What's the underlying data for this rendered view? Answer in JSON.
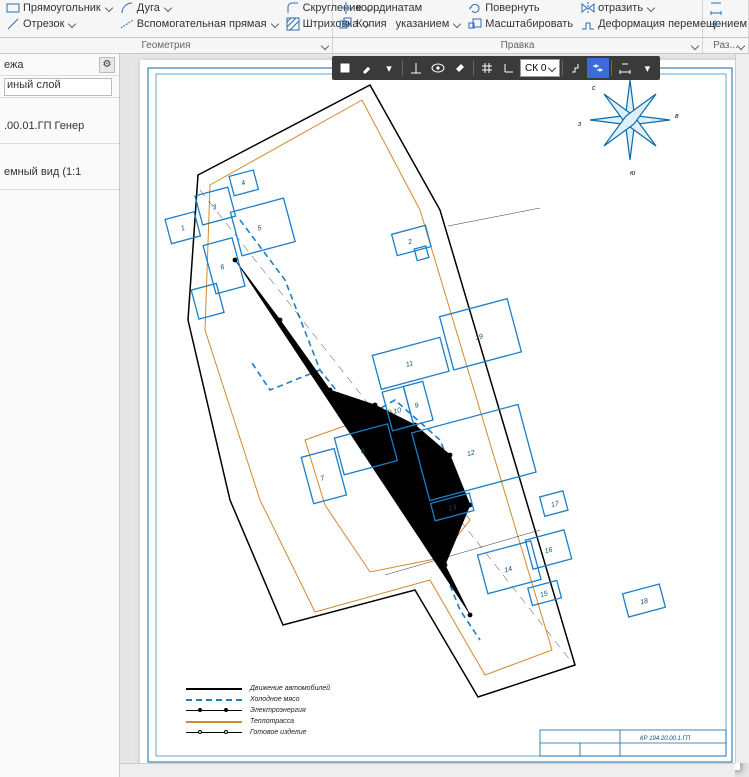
{
  "ribbon": {
    "geom": {
      "label": "Геометрия",
      "rect": "Прямоугольник",
      "line": "Отрезок",
      "arc": "Дуга",
      "round": "Скругление",
      "aux": "Вспомогательная прямая",
      "hatch": "Штриховка"
    },
    "edit": {
      "label": "Правка",
      "coords": "координатам",
      "point": "указанием",
      "copy": "Копия",
      "rotate": "Повернуть",
      "scale": "Масштабировать",
      "mirror": "отразить",
      "deform": "Деформация перемещением"
    },
    "dim": {
      "label": "Раз..."
    }
  },
  "side": {
    "tab": "ежа",
    "layer": "иный слой",
    "doc": ".00.01.ГП Генер",
    "view": "емный вид (1:1"
  },
  "viewbar": {
    "cs_label": "СК 0"
  },
  "compass": {
    "letters": [
      "с",
      "в",
      "з",
      "ю"
    ]
  },
  "blocks": {
    "n1": "1",
    "n2": "2",
    "n3": "3",
    "n4": "4",
    "n5": "5",
    "n6": "6",
    "n7": "7",
    "n8": "8",
    "n9": "9",
    "n10": "10",
    "n11": "11",
    "n12": "12",
    "n13": "13",
    "n14": "14",
    "n15": "15",
    "n16": "16",
    "n17": "17",
    "n18": "18",
    "n19": "19"
  },
  "legend": {
    "l1": "Движение автомобилей",
    "l2": "Холодное мясо",
    "l3": "Электроэнергия",
    "l4": "Теплотрасса",
    "l5": "Готовое изделие"
  },
  "stamp": {
    "code": "КР 194.20.00.1.ГП"
  }
}
